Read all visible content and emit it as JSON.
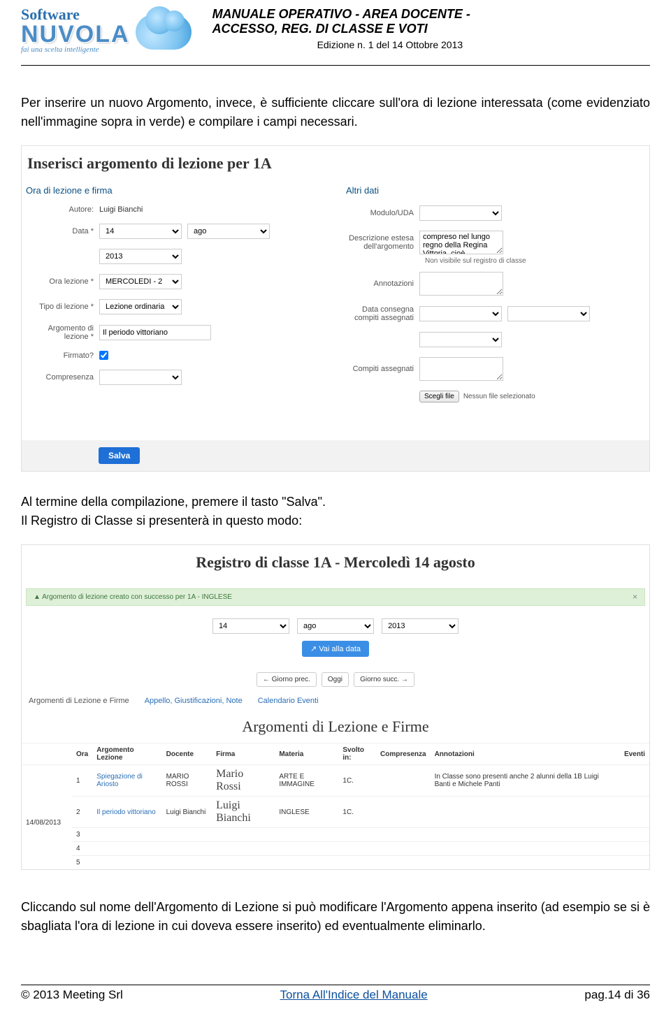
{
  "header": {
    "logo_software": "Software",
    "logo_brand": "NUVOLA",
    "logo_tag": "fai una scelta intelligente",
    "title_line1": "MANUALE OPERATIVO - AREA DOCENTE -",
    "title_line2": "ACCESSO, REG. DI CLASSE E VOTI",
    "edition": "Edizione n. 1 del 14 Ottobre 2013"
  },
  "para1": "Per inserire un nuovo Argomento, invece, è sufficiente cliccare sull'ora di lezione interessata (come evidenziato nell'immagine sopra in verde) e compilare i campi necessari.",
  "form": {
    "title": "Inserisci argomento di lezione per 1A",
    "left_section": "Ora di lezione e firma",
    "right_section": "Altri dati",
    "labels": {
      "autore": "Autore:",
      "data": "Data *",
      "ora": "Ora lezione *",
      "tipo": "Tipo di lezione *",
      "argomento": "Argomento di lezione *",
      "firmato": "Firmato?",
      "compresenza": "Compresenza",
      "modulo": "Modulo/UDA",
      "desc": "Descrizione estesa dell'argomento",
      "note_vis": "Non visibile sul registro di classe",
      "annot": "Annotazioni",
      "compiti_data": "Data consegna compiti assegnati",
      "compiti": "Compiti assegnati",
      "file_btn": "Scegli file",
      "file_none": "Nessun file selezionato"
    },
    "values": {
      "autore": "Luigi Bianchi",
      "day": "14",
      "month": "ago",
      "year": "2013",
      "ora": "MERCOLEDI - 2",
      "tipo": "Lezione ordinaria",
      "argomento": "Il periodo vittoriano",
      "desc": "compreso nel lungo regno della Regina Vittoria, cioè"
    },
    "salva": "Salva"
  },
  "para2a": "Al termine della compilazione, premere il tasto \"Salva\".",
  "para2b": "Il Registro di Classe si presenterà in questo modo:",
  "registro": {
    "title": "Registro di classe 1A - Mercoledì 14 agosto",
    "alert": "Argomento di lezione creato con successo per 1A - INGLESE",
    "date": {
      "day": "14",
      "month": "ago",
      "year": "2013"
    },
    "vai": "↗ Vai alla data",
    "nav": {
      "prev": "← Giorno prec.",
      "oggi": "Oggi",
      "succ": "Giorno succ. →"
    },
    "tabs": [
      "Argomenti di Lezione e Firme",
      "Appello, Giustificazioni, Note",
      "Calendario Eventi"
    ],
    "arg_title": "Argomenti di Lezione e Firme",
    "cols": [
      "Ora",
      "Argomento Lezione",
      "Docente",
      "Firma",
      "Materia",
      "Svolto in:",
      "Compresenza",
      "Annotazioni",
      "Eventi"
    ],
    "date_side": "14/08/2013",
    "rows": [
      {
        "ora": "1",
        "arg": "Spiegazione di Ariosto",
        "doc": "MARIO ROSSI",
        "sig": "Mario Rossi",
        "mat": "ARTE E IMMAGINE",
        "sv": "1C.",
        "comp": "",
        "ann": "In Classe sono presenti anche 2 alunni della 1B Luigi Banti e Michele Panti",
        "ev": ""
      },
      {
        "ora": "2",
        "arg": "Il periodo vittoriano",
        "doc": "Luigi Bianchi",
        "sig": "Luigi Bianchi",
        "mat": "INGLESE",
        "sv": "1C.",
        "comp": "",
        "ann": "",
        "ev": ""
      },
      {
        "ora": "3",
        "arg": "",
        "doc": "",
        "sig": "",
        "mat": "",
        "sv": "",
        "comp": "",
        "ann": "",
        "ev": ""
      },
      {
        "ora": "4",
        "arg": "",
        "doc": "",
        "sig": "",
        "mat": "",
        "sv": "",
        "comp": "",
        "ann": "",
        "ev": ""
      },
      {
        "ora": "5",
        "arg": "",
        "doc": "",
        "sig": "",
        "mat": "",
        "sv": "",
        "comp": "",
        "ann": "",
        "ev": ""
      }
    ]
  },
  "para3": "Cliccando sul nome dell'Argomento di Lezione si può modificare l'Argomento appena inserito (ad esempio se si è sbagliata l'ora di lezione in cui doveva essere inserito) ed eventualmente eliminarlo.",
  "footer": {
    "left": "© 2013 Meeting Srl",
    "center": "Torna All'Indice del Manuale",
    "right": "pag.14 di 36"
  }
}
